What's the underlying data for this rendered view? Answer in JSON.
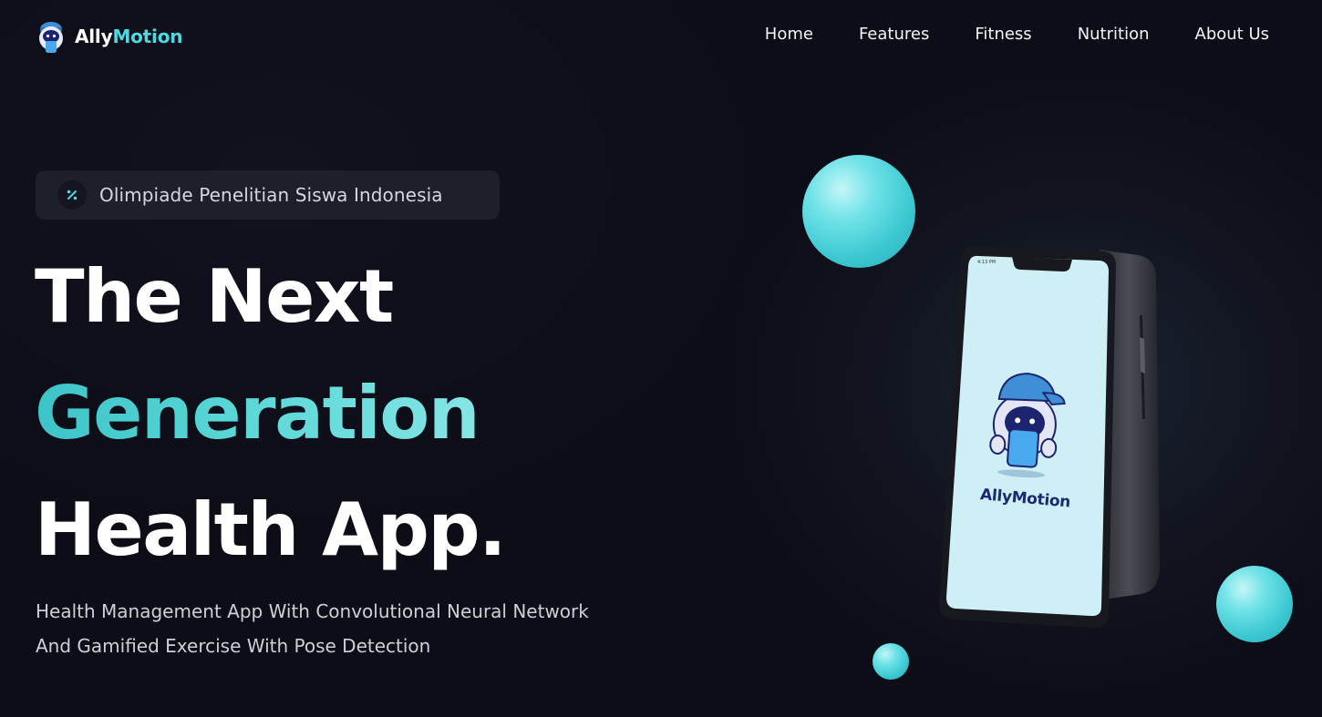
{
  "brand": {
    "name_part1": "Ally",
    "name_part2": "Motion",
    "accent": "#4fd8e2"
  },
  "nav": {
    "items": [
      {
        "label": "Home"
      },
      {
        "label": "Features"
      },
      {
        "label": "Fitness"
      },
      {
        "label": "Nutrition"
      },
      {
        "label": "About Us"
      }
    ]
  },
  "badge": {
    "icon": "percent-icon",
    "text": "Olimpiade Penelitian Siswa Indonesia"
  },
  "hero": {
    "line1": "The Next",
    "line2": "Generation",
    "line3": "Health App.",
    "subtitle": "Health Management App With Convolutional Neural Network And Gamified Exercise With Pose Detection"
  },
  "phone": {
    "app_name": "AllyMotion",
    "status_time": "4:13 PM"
  },
  "colors": {
    "background": "#0e0e19",
    "accent": "#4fd8e2",
    "sphere": "#3cc8d1",
    "phone_screen": "#cfeff7"
  }
}
